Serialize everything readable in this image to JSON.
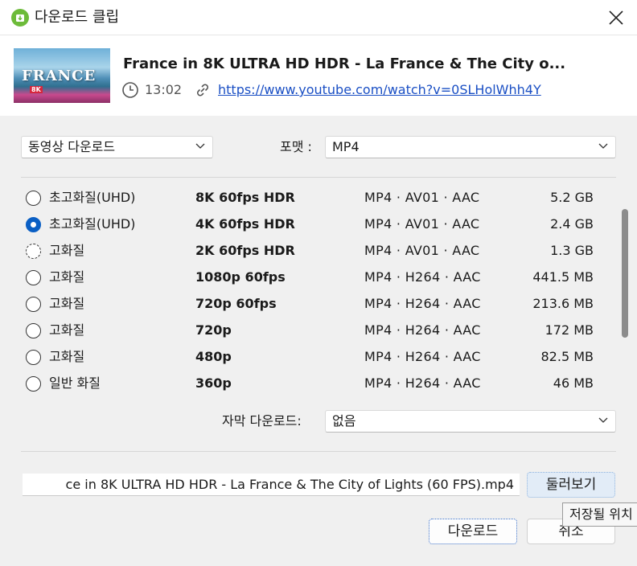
{
  "window": {
    "title": "다운로드 클립"
  },
  "video": {
    "title": "France in 8K ULTRA HD HDR - La France & The City o...",
    "thumbnail_text": "FRANCE",
    "thumbnail_badge": "8K",
    "duration": "13:02",
    "url": "https://www.youtube.com/watch?v=0SLHolWhh4Y"
  },
  "mode_select": {
    "value": "동영상 다운로드"
  },
  "format": {
    "label": "포맷 :",
    "value": "MP4"
  },
  "qualities": [
    {
      "label": "초고화질(UHD)",
      "resolution": "8K 60fps HDR",
      "codec": "MP4 · AV01 · AAC",
      "size": "5.2 GB",
      "state": "unchecked"
    },
    {
      "label": "초고화질(UHD)",
      "resolution": "4K 60fps HDR",
      "codec": "MP4 · AV01 · AAC",
      "size": "2.4 GB",
      "state": "checked"
    },
    {
      "label": "고화질",
      "resolution": "2K 60fps HDR",
      "codec": "MP4 · AV01 · AAC",
      "size": "1.3 GB",
      "state": "focused"
    },
    {
      "label": "고화질",
      "resolution": "1080p 60fps",
      "codec": "MP4 · H264 · AAC",
      "size": "441.5 MB",
      "state": "unchecked"
    },
    {
      "label": "고화질",
      "resolution": "720p 60fps",
      "codec": "MP4 · H264 · AAC",
      "size": "213.6 MB",
      "state": "unchecked"
    },
    {
      "label": "고화질",
      "resolution": "720p",
      "codec": "MP4 · H264 · AAC",
      "size": "172 MB",
      "state": "unchecked"
    },
    {
      "label": "고화질",
      "resolution": "480p",
      "codec": "MP4 · H264 · AAC",
      "size": "82.5 MB",
      "state": "unchecked"
    },
    {
      "label": "일반 화질",
      "resolution": "360p",
      "codec": "MP4 · H264 · AAC",
      "size": "46 MB",
      "state": "unchecked"
    }
  ],
  "subtitle": {
    "label": "자막 다운로드:",
    "value": "없음"
  },
  "filename": "ce in 8K ULTRA HD HDR - La France & The City of Lights (60 FPS).mp4",
  "buttons": {
    "browse": "둘러보기",
    "download": "다운로드",
    "cancel": "취소"
  },
  "tooltip": "저장될 위치",
  "colors": {
    "accent": "#0a5fc4",
    "link": "#1a4fc4",
    "app_icon": "#6dbb3a"
  },
  "icons": {
    "app": "download-app-icon",
    "close": "close-icon",
    "clock": "clock-icon",
    "link": "link-icon",
    "chevron": "chevron-down-icon"
  }
}
